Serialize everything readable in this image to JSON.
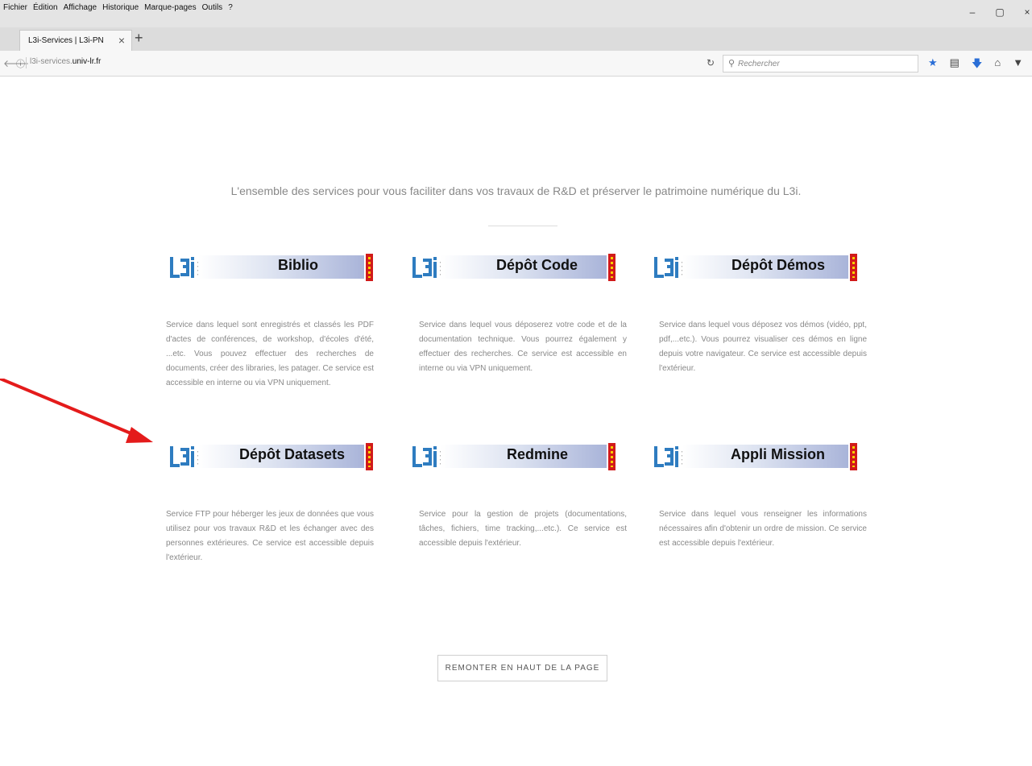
{
  "browser": {
    "menu": [
      "Fichier",
      "Édition",
      "Affichage",
      "Historique",
      "Marque-pages",
      "Outils",
      "?"
    ],
    "window_controls": [
      "–",
      "▢",
      "×"
    ],
    "tab_title": "L3i-Services | L3i-PN",
    "tab_close": "×",
    "new_tab": "+",
    "url_prefix": "l3i-services.",
    "url_domain": "univ-lr.fr",
    "search_placeholder": "Rechercher"
  },
  "page": {
    "tagline": "L'ensemble des services pour vous faciliter dans vos travaux de R&D et préserver le patrimoine numérique du L3i.",
    "back_to_top": "REMONTER EN HAUT DE LA PAGE",
    "services": [
      {
        "title": "Biblio",
        "description": "Service dans lequel sont enregistrés et classés les PDF d'actes de conférences, de workshop, d'écoles d'été, ...etc. Vous pouvez effectuer des recherches de documents, créer des libraries, les patager. Ce service est accessible en interne ou via VPN uniquement."
      },
      {
        "title": "Dépôt Code",
        "description": "Service dans lequel vous déposerez votre code et de la documentation technique. Vous pourrez également y effectuer des recherches. Ce service est accessible en interne ou via VPN uniquement."
      },
      {
        "title": "Dépôt Démos",
        "description": "Service dans lequel vous déposez vos démos (vidéo, ppt, pdf,...etc.). Vous pourrez visualiser ces démos en ligne depuis votre navigateur. Ce service est accessible depuis l'extérieur."
      },
      {
        "title": "Dépôt Datasets",
        "description": "Service FTP pour héberger les jeux de données que vous utilisez pour vos travaux R&D et les échanger avec des personnes extérieures. Ce service est accessible depuis l'extérieur."
      },
      {
        "title": "Redmine",
        "description": "Service pour la gestion de projets (documentations, tâches, fichiers, time tracking,...etc.). Ce service est accessible depuis l'extérieur."
      },
      {
        "title": "Appli Mission",
        "description": "Service dans lequel vous renseigner les informations nécessaires afin d'obtenir un ordre de mission. Ce service est accessible depuis l'extérieur."
      }
    ]
  },
  "colors": {
    "arrow": "#e41b1b",
    "logo_blue": "#2e7cc0",
    "tag_red": "#d11a1a"
  }
}
